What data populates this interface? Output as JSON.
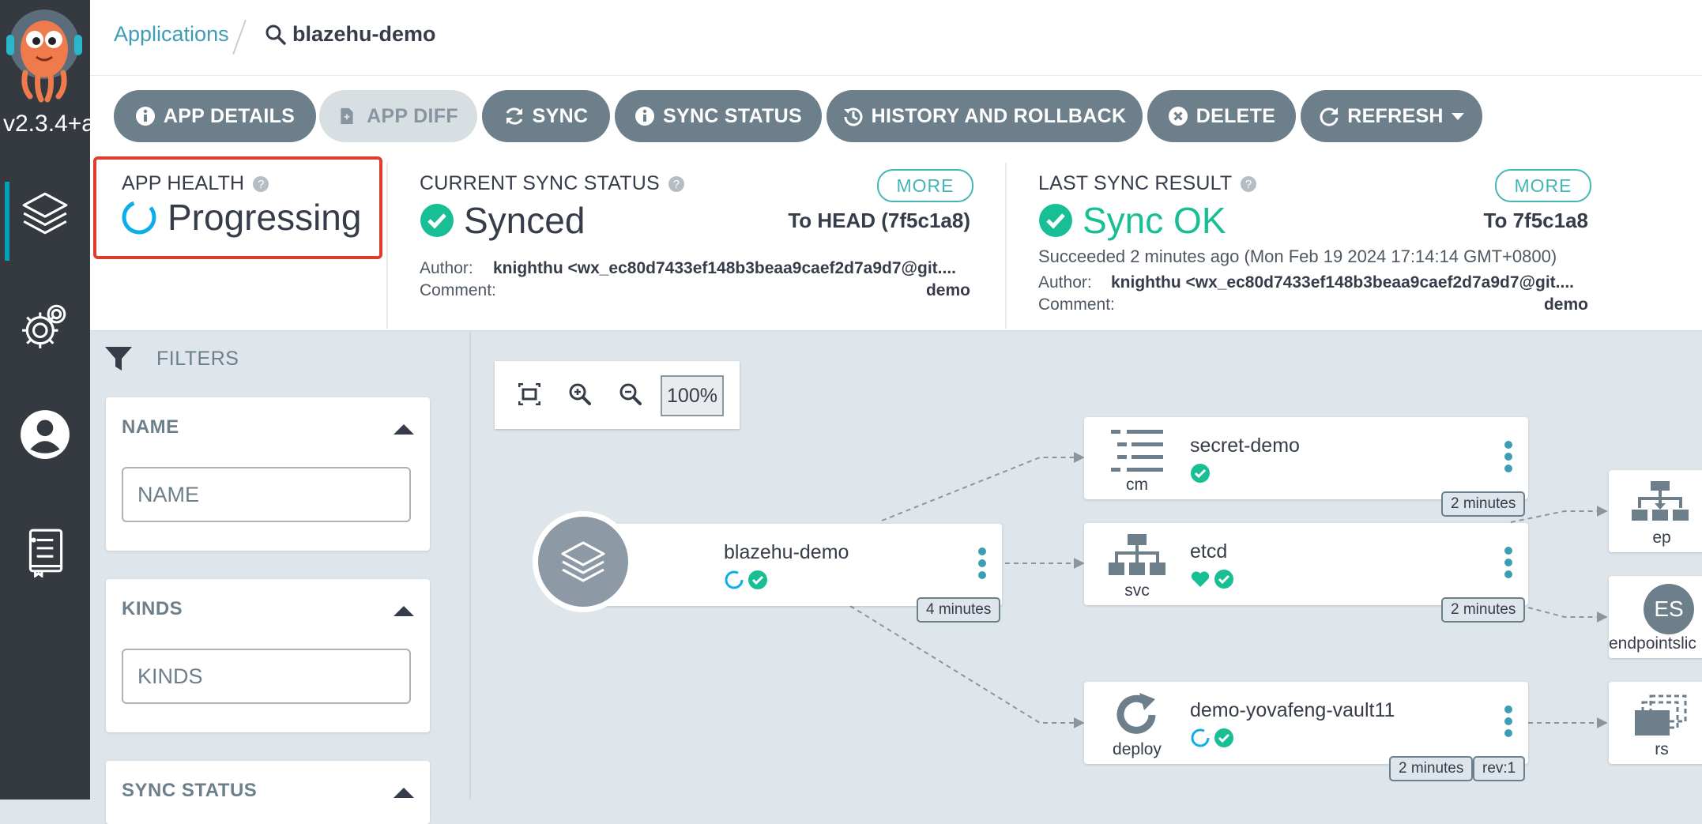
{
  "app": {
    "version": "v2.3.4+a"
  },
  "breadcrumb": {
    "root": "Applications",
    "current": "blazehu-demo"
  },
  "toolbar": {
    "app_details": "APP DETAILS",
    "app_diff": "APP DIFF",
    "sync": "SYNC",
    "sync_status": "SYNC STATUS",
    "history": "HISTORY AND ROLLBACK",
    "delete": "DELETE",
    "refresh": "REFRESH"
  },
  "health": {
    "title": "APP HEALTH",
    "status": "Progressing"
  },
  "sync": {
    "title": "CURRENT SYNC STATUS",
    "more": "MORE",
    "status": "Synced",
    "target": "To HEAD (7f5c1a8)",
    "author_label": "Author:",
    "author": "knighthu <wx_ec80d7433ef148b3beaa9caef2d7a9d7@git....",
    "comment_label": "Comment:",
    "comment": "demo"
  },
  "last_sync": {
    "title": "LAST SYNC RESULT",
    "more": "MORE",
    "status": "Sync OK",
    "target": "To 7f5c1a8",
    "succeeded": "Succeeded 2 minutes ago (Mon Feb 19 2024 17:14:14 GMT+0800)",
    "author_label": "Author:",
    "author": "knighthu <wx_ec80d7433ef148b3beaa9caef2d7a9d7@git....",
    "comment_label": "Comment:",
    "comment": "demo"
  },
  "filters": {
    "title": "FILTERS",
    "name_label": "NAME",
    "name_placeholder": "NAME",
    "kinds_label": "KINDS",
    "kinds_placeholder": "KINDS",
    "sync_status_label": "SYNC STATUS"
  },
  "zoom": {
    "level": "100%"
  },
  "graph": {
    "root": {
      "name": "blazehu-demo",
      "age": "4 minutes"
    },
    "nodes": {
      "secret": {
        "kind": "cm",
        "name": "secret-demo",
        "age": "2 minutes"
      },
      "etcd": {
        "kind": "svc",
        "name": "etcd",
        "age": "2 minutes"
      },
      "deploy": {
        "kind": "deploy",
        "name": "demo-yovafeng-vault11",
        "age": "2 minutes",
        "rev": "rev:1"
      },
      "ep": {
        "kind": "ep"
      },
      "endpointslice": {
        "kind": "endpointslic",
        "icon_text": "ES"
      },
      "rs": {
        "kind": "rs"
      }
    }
  },
  "colors": {
    "accent": "#3d9db5",
    "success": "#18be94",
    "progress": "#0dadea",
    "sidebar": "#343a3f",
    "highlight": "#e03c2d"
  }
}
